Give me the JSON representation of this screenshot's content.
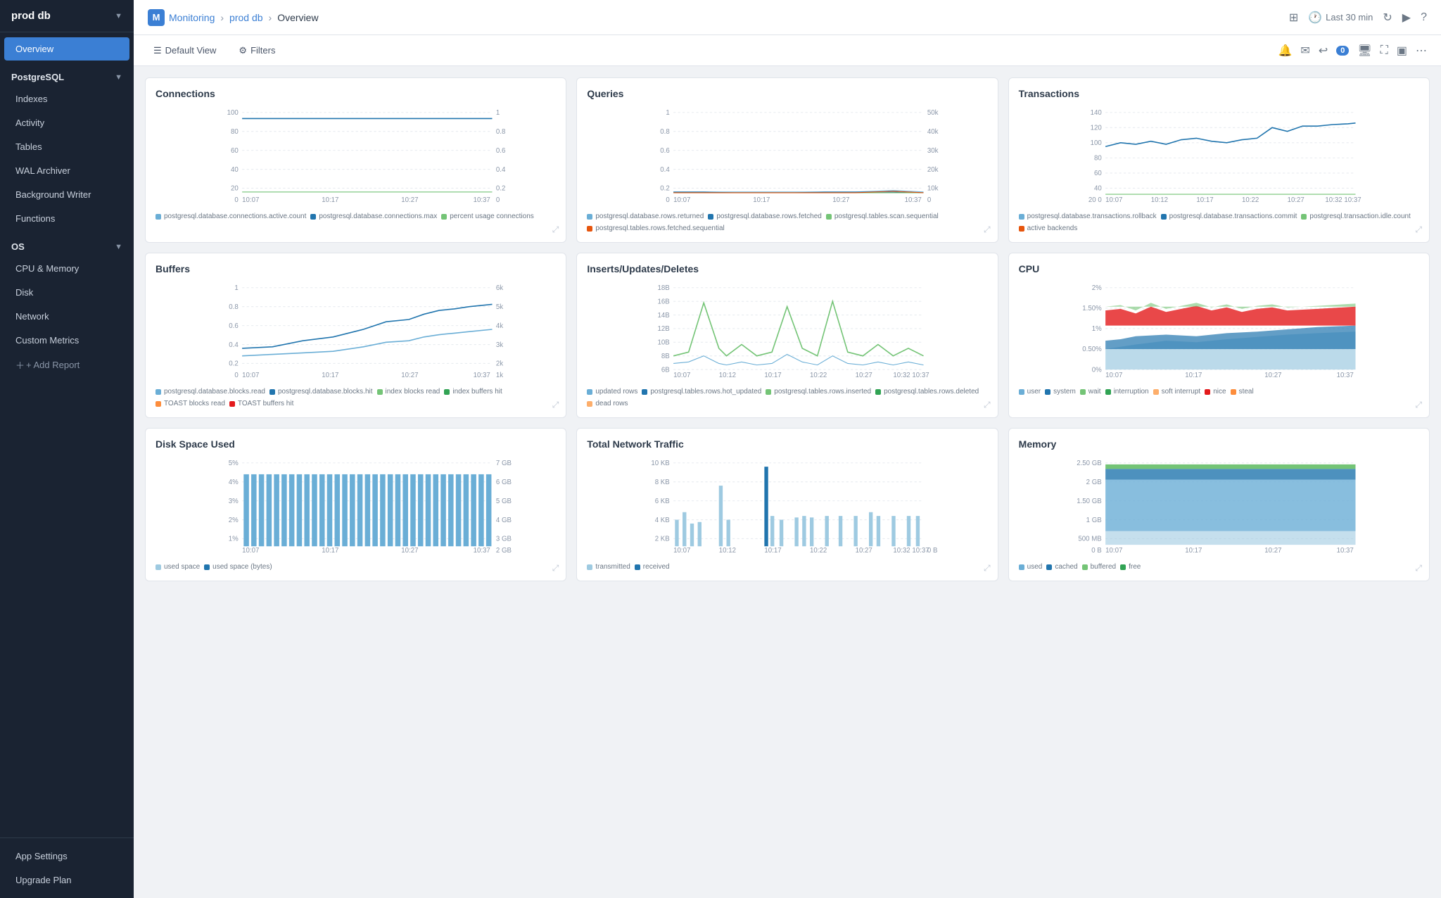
{
  "sidebar": {
    "db_name": "prod db",
    "overview": "Overview",
    "postgresql": {
      "label": "PostgreSQL",
      "items": [
        "Indexes",
        "Activity",
        "Tables",
        "WAL Archiver",
        "Background Writer",
        "Functions"
      ]
    },
    "os": {
      "label": "OS",
      "items": [
        "CPU & Memory",
        "Disk",
        "Network",
        "Custom Metrics"
      ]
    },
    "add_report": "+ Add Report",
    "bottom_items": [
      "App Settings",
      "Upgrade Plan"
    ]
  },
  "topnav": {
    "monitoring": "Monitoring",
    "prod_db": "prod db",
    "overview": "Overview",
    "time_range": "Last 30 min",
    "brand_letter": "M"
  },
  "toolbar": {
    "default_view": "Default View",
    "filters": "Filters",
    "notification_count": "0"
  },
  "charts": {
    "connections": {
      "title": "Connections",
      "legend": [
        {
          "label": "postgresql.database.connections.active.count",
          "color": "#6aaed6"
        },
        {
          "label": "postgresql.database.connections.max",
          "color": "#2175ae"
        },
        {
          "label": "percent usage connections",
          "color": "#74c476"
        }
      ]
    },
    "queries": {
      "title": "Queries",
      "legend": [
        {
          "label": "postgresql.database.rows.returned",
          "color": "#6aaed6"
        },
        {
          "label": "postgresql.database.rows.fetched",
          "color": "#2175ae"
        },
        {
          "label": "postgresql.tables.scan.sequential",
          "color": "#74c476"
        },
        {
          "label": "postgresql.tables.rows.fetched.sequential",
          "color": "#e6550d"
        }
      ]
    },
    "transactions": {
      "title": "Transactions",
      "legend": [
        {
          "label": "postgresql.database.transactions.rollback",
          "color": "#6aaed6"
        },
        {
          "label": "postgresql.database.transactions.commit",
          "color": "#2175ae"
        },
        {
          "label": "postgresql.transaction.idle.count",
          "color": "#74c476"
        },
        {
          "label": "active backends",
          "color": "#e6550d"
        }
      ]
    },
    "buffers": {
      "title": "Buffers",
      "legend": [
        {
          "label": "postgresql.database.blocks.read",
          "color": "#6aaed6"
        },
        {
          "label": "postgresql.database.blocks.hit",
          "color": "#2175ae"
        },
        {
          "label": "index blocks read",
          "color": "#74c476"
        },
        {
          "label": "index buffers hit",
          "color": "#31a354"
        },
        {
          "label": "TOAST blocks read",
          "color": "#fd8d3c"
        },
        {
          "label": "TOAST buffers hit",
          "color": "#e31a1c"
        }
      ]
    },
    "inserts": {
      "title": "Inserts/Updates/Deletes",
      "legend": [
        {
          "label": "updated rows",
          "color": "#6aaed6"
        },
        {
          "label": "postgresql.tables.rows.hot_updated",
          "color": "#2175ae"
        },
        {
          "label": "postgresql.tables.rows.inserted",
          "color": "#74c476"
        },
        {
          "label": "postgresql.tables.rows.deleted",
          "color": "#31a354"
        },
        {
          "label": "dead rows",
          "color": "#fdae6b"
        }
      ]
    },
    "cpu": {
      "title": "CPU",
      "legend": [
        {
          "label": "user",
          "color": "#6baed6"
        },
        {
          "label": "system",
          "color": "#2175ae"
        },
        {
          "label": "wait",
          "color": "#74c476"
        },
        {
          "label": "interruption",
          "color": "#31a354"
        },
        {
          "label": "soft interrupt",
          "color": "#fdae6b"
        },
        {
          "label": "nice",
          "color": "#e31a1c"
        },
        {
          "label": "steal",
          "color": "#fd8d3c"
        }
      ]
    },
    "disk_space": {
      "title": "Disk Space Used",
      "legend": [
        {
          "label": "used space",
          "color": "#6aaed6"
        },
        {
          "label": "used space (bytes)",
          "color": "#2175ae"
        }
      ]
    },
    "network": {
      "title": "Total Network Traffic",
      "legend": [
        {
          "label": "transmitted",
          "color": "#9ecae1"
        },
        {
          "label": "received",
          "color": "#2175ae"
        }
      ]
    },
    "memory": {
      "title": "Memory",
      "legend": [
        {
          "label": "used",
          "color": "#6aaed6"
        },
        {
          "label": "cached",
          "color": "#2175ae"
        },
        {
          "label": "buffered",
          "color": "#74c476"
        },
        {
          "label": "free",
          "color": "#31a354"
        }
      ]
    }
  },
  "time_labels": {
    "short": [
      "10:07",
      "10:17",
      "10:27",
      "10:37"
    ],
    "long": [
      "10:07",
      "10:12",
      "10:17",
      "10:22",
      "10:27",
      "10:32",
      "10:37"
    ]
  }
}
